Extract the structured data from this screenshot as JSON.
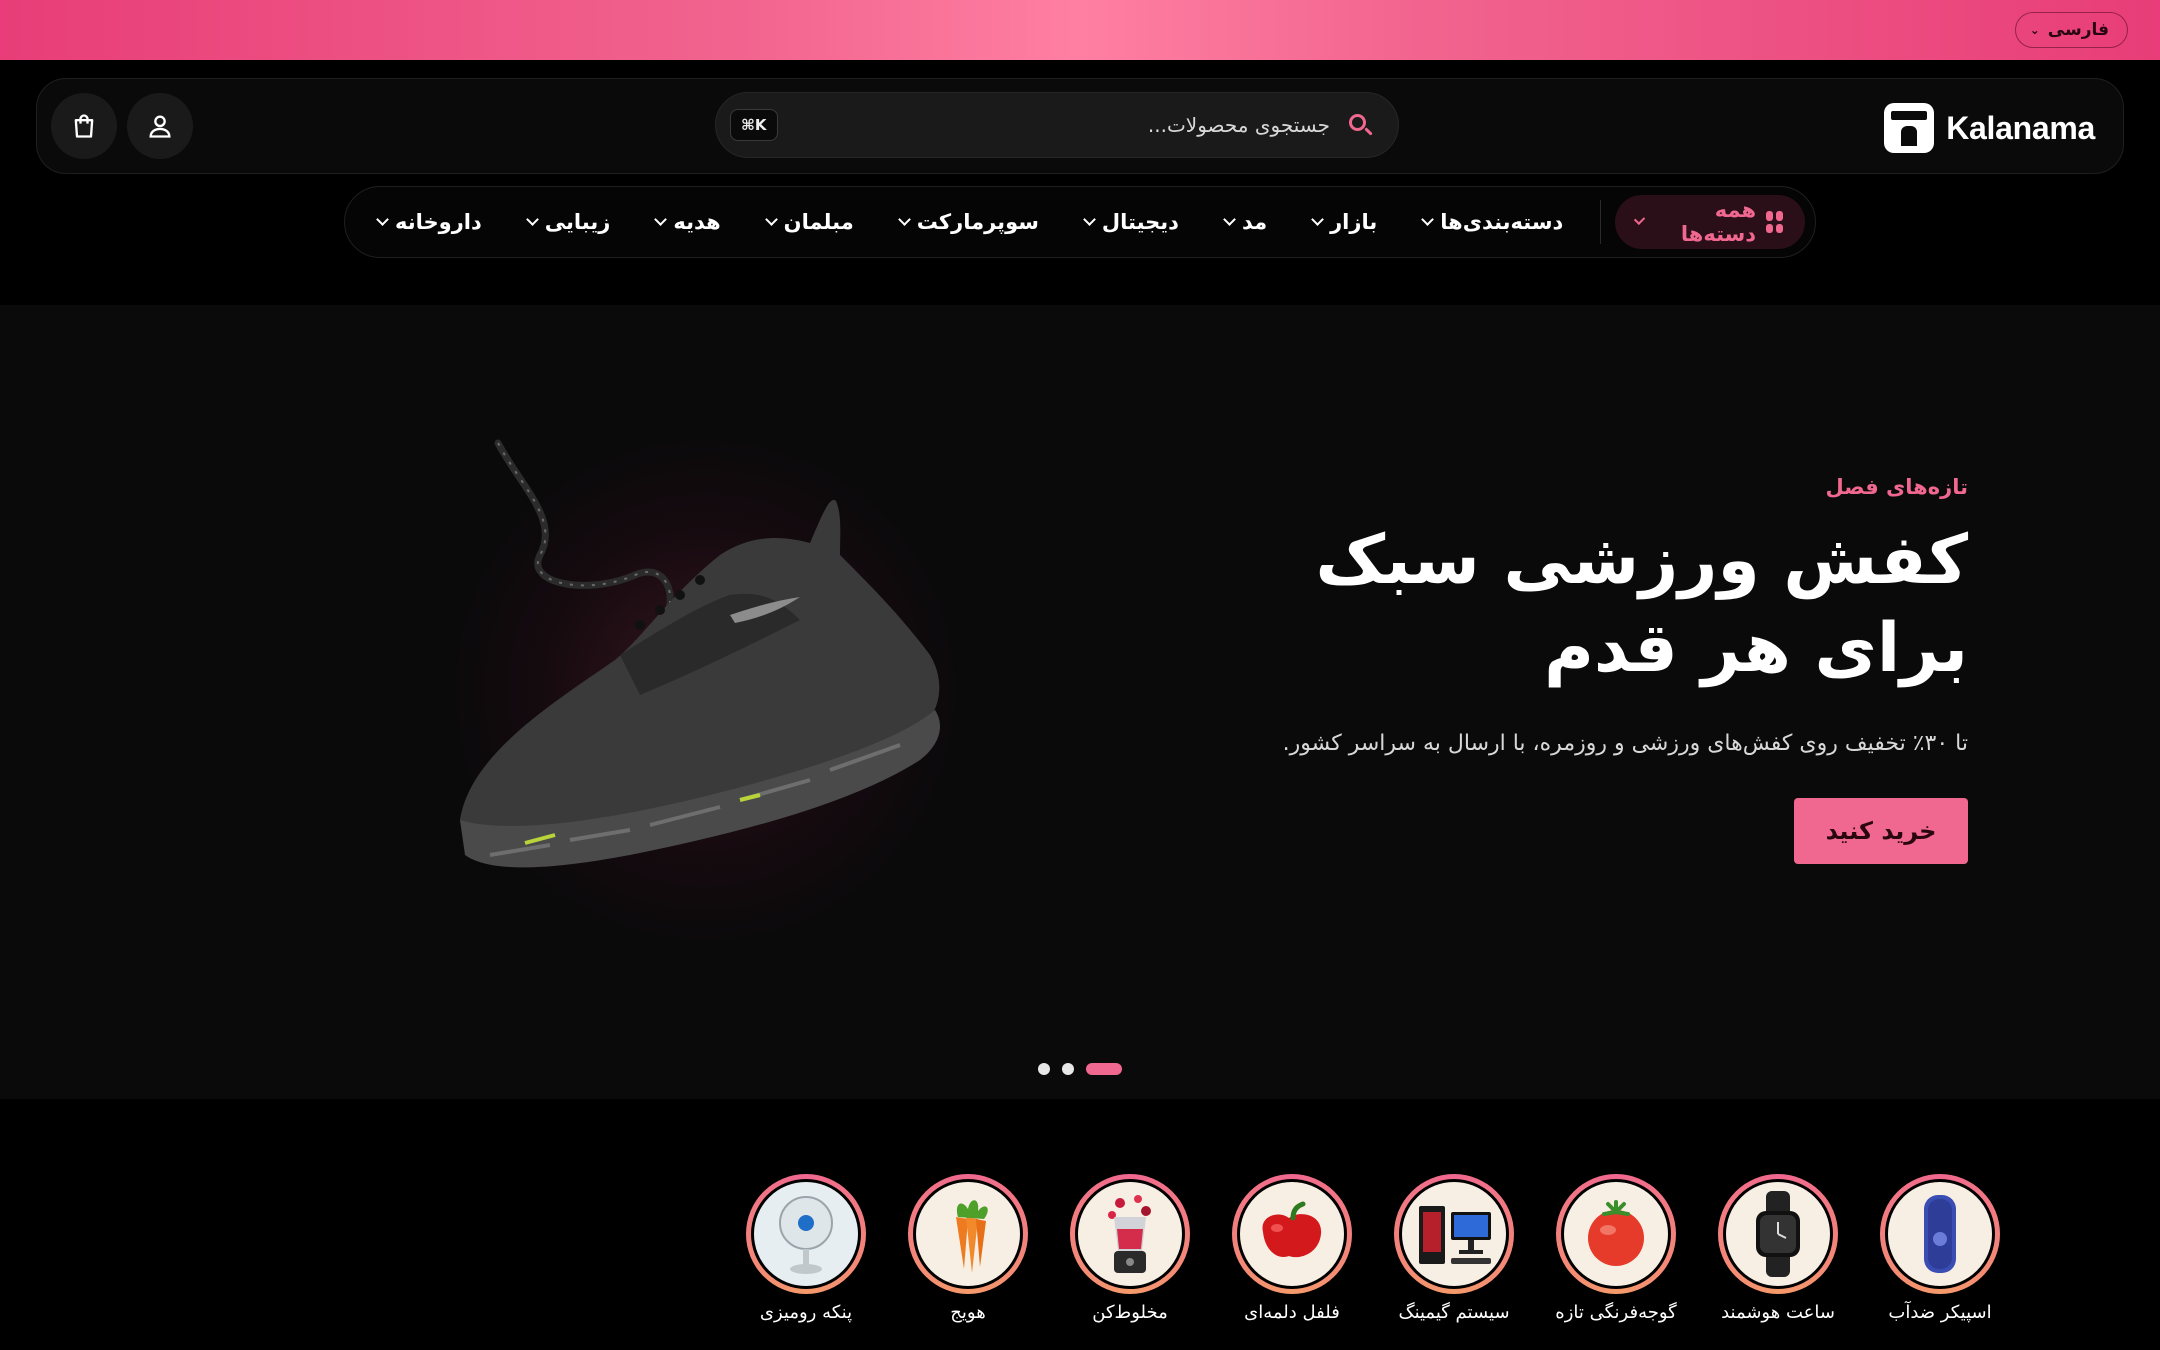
{
  "topbar": {
    "language_label": "فارسی"
  },
  "header": {
    "logo_text": "Kalanama",
    "search_placeholder": "جستجوی محصولات...",
    "search_shortcut": "⌘K",
    "icons": {
      "user": "user-icon",
      "cart": "shopping-bag-icon",
      "search": "search-icon"
    }
  },
  "nav": {
    "all_categories": "همه دسته‌ها",
    "items": [
      "دسته‌بندی‌ها",
      "بازار",
      "مد",
      "دیجیتال",
      "سوپرمارکت",
      "مبلمان",
      "هدیه",
      "زیبایی",
      "داروخانه"
    ]
  },
  "hero": {
    "eyebrow": "تازه‌های فصل",
    "title": "کفش ورزشی سبک برای هر قدم",
    "subtitle": "تا ۳۰٪ تخفیف روی کفش‌های ورزشی و روزمره، با ارسال به سراسر کشور.",
    "cta": "خرید کنید",
    "slides_total": 3,
    "active_slide": 1
  },
  "categories": [
    {
      "label": "اسپیکر ضدآب",
      "icon": "speaker-icon"
    },
    {
      "label": "ساعت هوشمند",
      "icon": "smartwatch-icon"
    },
    {
      "label": "گوجه‌فرنگی تازه",
      "icon": "tomato-icon"
    },
    {
      "label": "سیستم گیمینگ",
      "icon": "gaming-pc-icon"
    },
    {
      "label": "فلفل دلمه‌ای",
      "icon": "bell-pepper-icon"
    },
    {
      "label": "مخلوط‌کن",
      "icon": "blender-icon"
    },
    {
      "label": "هویج",
      "icon": "carrot-icon"
    },
    {
      "label": "پنکه رومیزی",
      "icon": "desk-fan-icon"
    }
  ],
  "colors": {
    "accent": "#f0678f",
    "background": "#000000",
    "hero_bg": "#0b0a0b"
  }
}
